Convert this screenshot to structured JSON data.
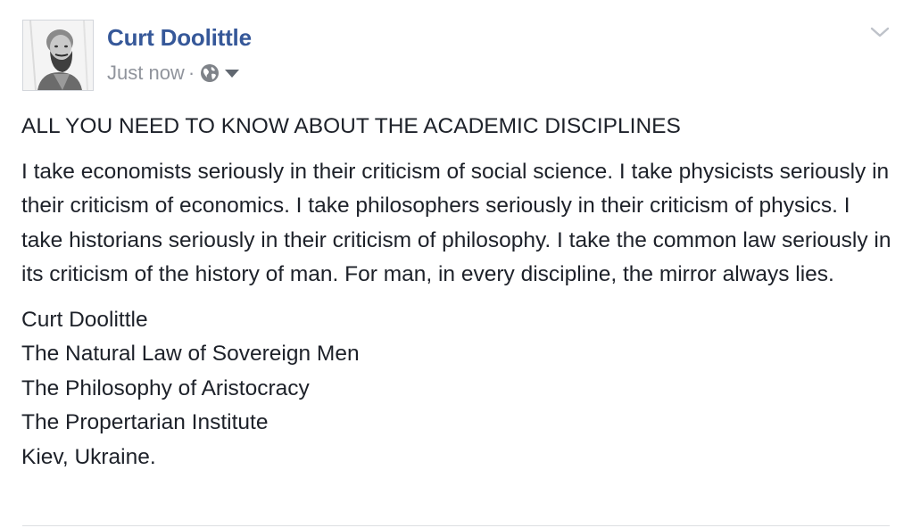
{
  "post": {
    "author_name": "Curt Doolittle",
    "timestamp": "Just now",
    "separator": "·",
    "privacy_icon": "globe-icon",
    "privacy_dropdown_icon": "caret-down-icon",
    "options_icon": "chevron-down-icon",
    "headline": "ALL YOU NEED TO KNOW ABOUT THE ACADEMIC DISCIPLINES",
    "body": "I take economists seriously in their criticism of social science. I take physicists seriously in their criticism of economics. I take philosophers seriously in their criticism of physics. I take historians seriously in their criticism of philosophy. I take the common law seriously in its criticism of the history of man. For man, in every discipline, the mirror always lies.",
    "signature": [
      "Curt Doolittle",
      "The Natural Law of Sovereign Men",
      "The Philosophy of Aristocracy",
      "The Propertarian Institute",
      "Kiev, Ukraine."
    ]
  },
  "colors": {
    "author_link": "#365899",
    "meta_text": "#90949c",
    "body_text": "#1d2129",
    "divider": "#dddfe2"
  }
}
